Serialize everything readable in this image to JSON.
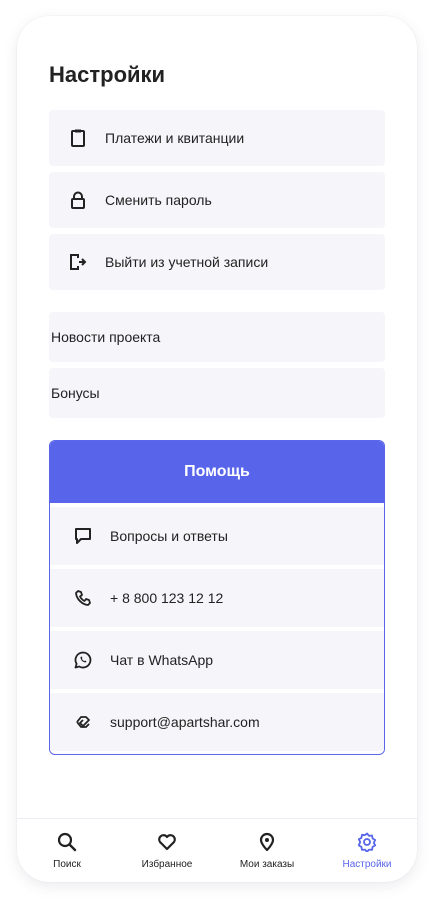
{
  "page": {
    "title": "Настройки"
  },
  "account_menu": [
    {
      "label": "Платежи и квитанции",
      "icon": "clipboard-icon"
    },
    {
      "label": "Сменить пароль",
      "icon": "lock-icon"
    },
    {
      "label": "Выйти из учетной записи",
      "icon": "logout-icon"
    }
  ],
  "info_menu": [
    {
      "label": "Новости проекта"
    },
    {
      "label": "Бонусы"
    }
  ],
  "help": {
    "title": "Помощь",
    "items": [
      {
        "label": "Вопросы и ответы",
        "icon": "chat-bubble-icon"
      },
      {
        "label": "+ 8 800 123 12 12",
        "icon": "phone-icon"
      },
      {
        "label": "Чат в WhatsApp",
        "icon": "whatsapp-icon"
      },
      {
        "label": "support@apartshar.com",
        "icon": "support-icon"
      }
    ]
  },
  "tabbar": {
    "accent": "#5865ea",
    "tabs": [
      {
        "label": "Поиск",
        "icon": "search-icon"
      },
      {
        "label": "Избранное",
        "icon": "heart-icon"
      },
      {
        "label": "Мои заказы",
        "icon": "location-pin-icon"
      },
      {
        "label": "Настройки",
        "icon": "gear-icon",
        "active": true
      }
    ]
  }
}
